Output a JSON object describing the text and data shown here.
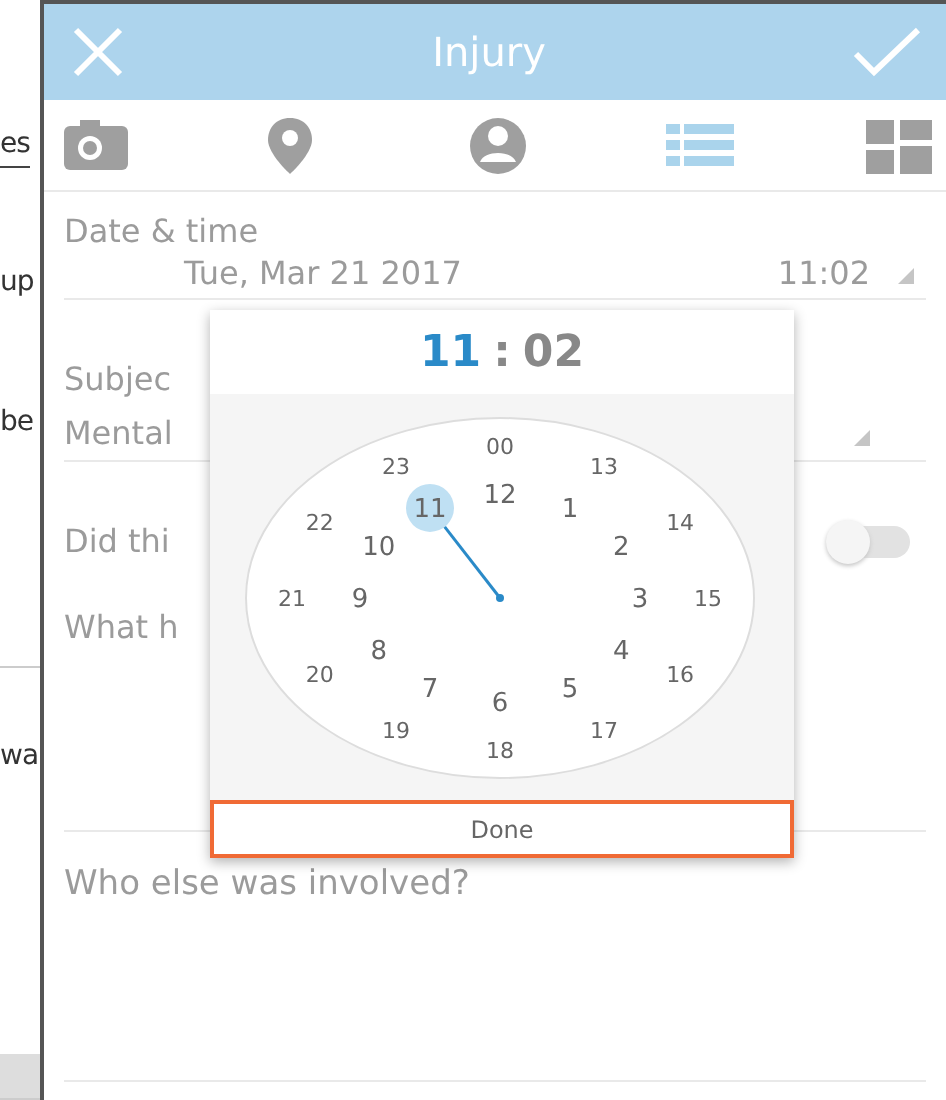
{
  "background_fragments": [
    {
      "text": "es"
    },
    {
      "text": "up"
    },
    {
      "text": "be"
    },
    {
      "text": "wa"
    }
  ],
  "header": {
    "title": "Injury"
  },
  "tabs": [
    {
      "kind": "camera",
      "selected": false
    },
    {
      "kind": "location",
      "selected": false
    },
    {
      "kind": "person",
      "selected": false
    },
    {
      "kind": "list",
      "selected": true
    },
    {
      "kind": "grid",
      "selected": false
    }
  ],
  "form": {
    "date_label": "Date & time",
    "date": "Tue, Mar 21 2017",
    "time": "11:02",
    "subject_label": "Subjec",
    "subject_value": "Mental",
    "toggle_label": "Did thi",
    "toggle": {
      "on": false
    },
    "what_label": "What h",
    "who_label": "Who else was involved?"
  },
  "time_picker": {
    "hour": {
      "text": "11",
      "selected": true
    },
    "separator": ":",
    "minute": {
      "text": "02",
      "selected": false
    },
    "outer": [
      {
        "label": "00",
        "selected": false
      },
      {
        "label": "13",
        "selected": false
      },
      {
        "label": "14",
        "selected": false
      },
      {
        "label": "15",
        "selected": false
      },
      {
        "label": "16",
        "selected": false
      },
      {
        "label": "17",
        "selected": false
      },
      {
        "label": "18",
        "selected": false
      },
      {
        "label": "19",
        "selected": false
      },
      {
        "label": "20",
        "selected": false
      },
      {
        "label": "21",
        "selected": false
      },
      {
        "label": "22",
        "selected": false
      },
      {
        "label": "23",
        "selected": false
      }
    ],
    "inner": [
      {
        "label": "12",
        "selected": false
      },
      {
        "label": "1",
        "selected": false
      },
      {
        "label": "2",
        "selected": false
      },
      {
        "label": "3",
        "selected": false
      },
      {
        "label": "4",
        "selected": false
      },
      {
        "label": "5",
        "selected": false
      },
      {
        "label": "6",
        "selected": false
      },
      {
        "label": "7",
        "selected": false
      },
      {
        "label": "8",
        "selected": false
      },
      {
        "label": "9",
        "selected": false
      },
      {
        "label": "10",
        "selected": false
      },
      {
        "label": "11",
        "selected": true
      }
    ],
    "done": "Done"
  }
}
